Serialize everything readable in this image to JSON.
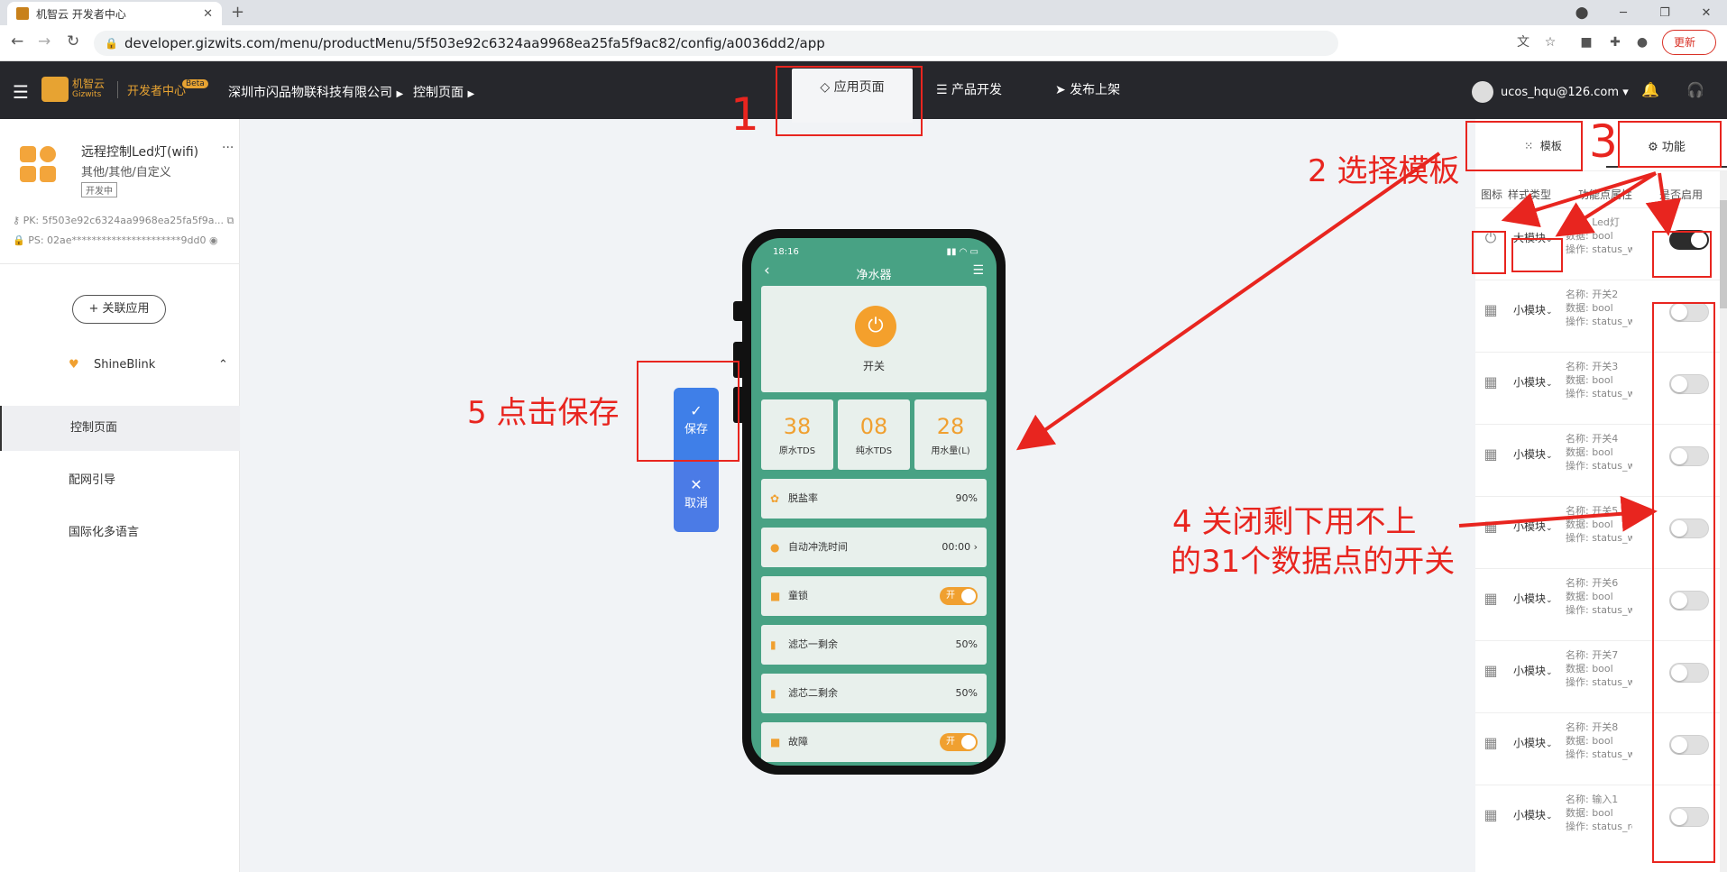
{
  "browser": {
    "tab_title": "机智云 开发者中心",
    "url": "developer.gizwits.com/menu/productMenu/5f503e92c6324aa9968ea25fa5f9ac82/config/a0036dd2/app",
    "update_label": "更新"
  },
  "header": {
    "logo_text_1": "机智云",
    "logo_text_2": "Gizwits",
    "dev_center": "开发者中心",
    "beta": "Beta",
    "company": "深圳市闪品物联科技有限公司",
    "crumb": "控制页面",
    "tabs": [
      "应用页面",
      "产品开发",
      "发布上架"
    ],
    "user": "ucos_hqu@126.com"
  },
  "sidebar": {
    "product_name": "远程控制Led灯(wifi)",
    "product_category": "其他/其他/自定义",
    "product_status": "开发中",
    "pk_label": "PK:",
    "pk_value": "5f503e92c6324aa9968ea25fa5f9a...",
    "ps_label": "PS:",
    "ps_value": "02ae**********************9dd0",
    "link_app": "+ 关联应用",
    "app_name": "ShineBlink",
    "items": [
      "控制页面",
      "配网引导",
      "国际化多语言"
    ]
  },
  "phone": {
    "time": "18:16",
    "title": "净水器",
    "power_label": "开关",
    "stats": [
      {
        "num": "38",
        "label": "原水TDS"
      },
      {
        "num": "08",
        "label": "纯水TDS"
      },
      {
        "num": "28",
        "label": "用水量(L)"
      }
    ],
    "rows": [
      {
        "label": "脱盐率",
        "value": "90%",
        "type": "value"
      },
      {
        "label": "自动冲洗时间",
        "value": "00:00",
        "type": "value"
      },
      {
        "label": "童锁",
        "value": "开",
        "type": "toggle"
      },
      {
        "label": "滤芯一剩余",
        "value": "50%",
        "type": "value"
      },
      {
        "label": "滤芯二剩余",
        "value": "50%",
        "type": "value"
      },
      {
        "label": "故障",
        "value": "开",
        "type": "toggle"
      }
    ]
  },
  "actions": {
    "save": "保存",
    "cancel": "取消"
  },
  "right_panel": {
    "tab_template": "模板",
    "tab_function": "功能",
    "col_icon": "图标",
    "col_style": "样式类型",
    "col_attr": "功能点属性",
    "col_enable": "是否启用",
    "rows": [
      {
        "style": "大模块",
        "name": "名称: Led灯",
        "data": "数据: bool",
        "op": "操作: status_writable",
        "enabled": true,
        "icon": "power-icon"
      },
      {
        "style": "小模块",
        "name": "名称: 开关2",
        "data": "数据: bool",
        "op": "操作: status_writable",
        "enabled": false,
        "icon": "grid-icon"
      },
      {
        "style": "小模块",
        "name": "名称: 开关3",
        "data": "数据: bool",
        "op": "操作: status_writable",
        "enabled": false,
        "icon": "grid-icon"
      },
      {
        "style": "小模块",
        "name": "名称: 开关4",
        "data": "数据: bool",
        "op": "操作: status_writable",
        "enabled": false,
        "icon": "grid-icon"
      },
      {
        "style": "小模块",
        "name": "名称: 开关5",
        "data": "数据: bool",
        "op": "操作: status_writable",
        "enabled": false,
        "icon": "grid-icon"
      },
      {
        "style": "小模块",
        "name": "名称: 开关6",
        "data": "数据: bool",
        "op": "操作: status_writable",
        "enabled": false,
        "icon": "grid-icon"
      },
      {
        "style": "小模块",
        "name": "名称: 开关7",
        "data": "数据: bool",
        "op": "操作: status_writable",
        "enabled": false,
        "icon": "grid-icon"
      },
      {
        "style": "小模块",
        "name": "名称: 开关8",
        "data": "数据: bool",
        "op": "操作: status_writable",
        "enabled": false,
        "icon": "grid-icon"
      },
      {
        "style": "小模块",
        "name": "名称: 输入1",
        "data": "数据: bool",
        "op": "操作: status_readonly",
        "enabled": false,
        "icon": "grid-icon"
      }
    ]
  },
  "annotations": {
    "n1": "1",
    "n2": "2 选择模板",
    "n3": "3",
    "n4_line1": "4 关闭剩下用不上",
    "n4_line2": "的31个数据点的开关",
    "n5": "5 点击保存",
    "color": "#e8251f"
  },
  "colors": {
    "header_bg": "#26272c",
    "accent_orange": "#f0a030",
    "phone_bg": "#48a284",
    "save_blue": "#3f7fe8"
  }
}
